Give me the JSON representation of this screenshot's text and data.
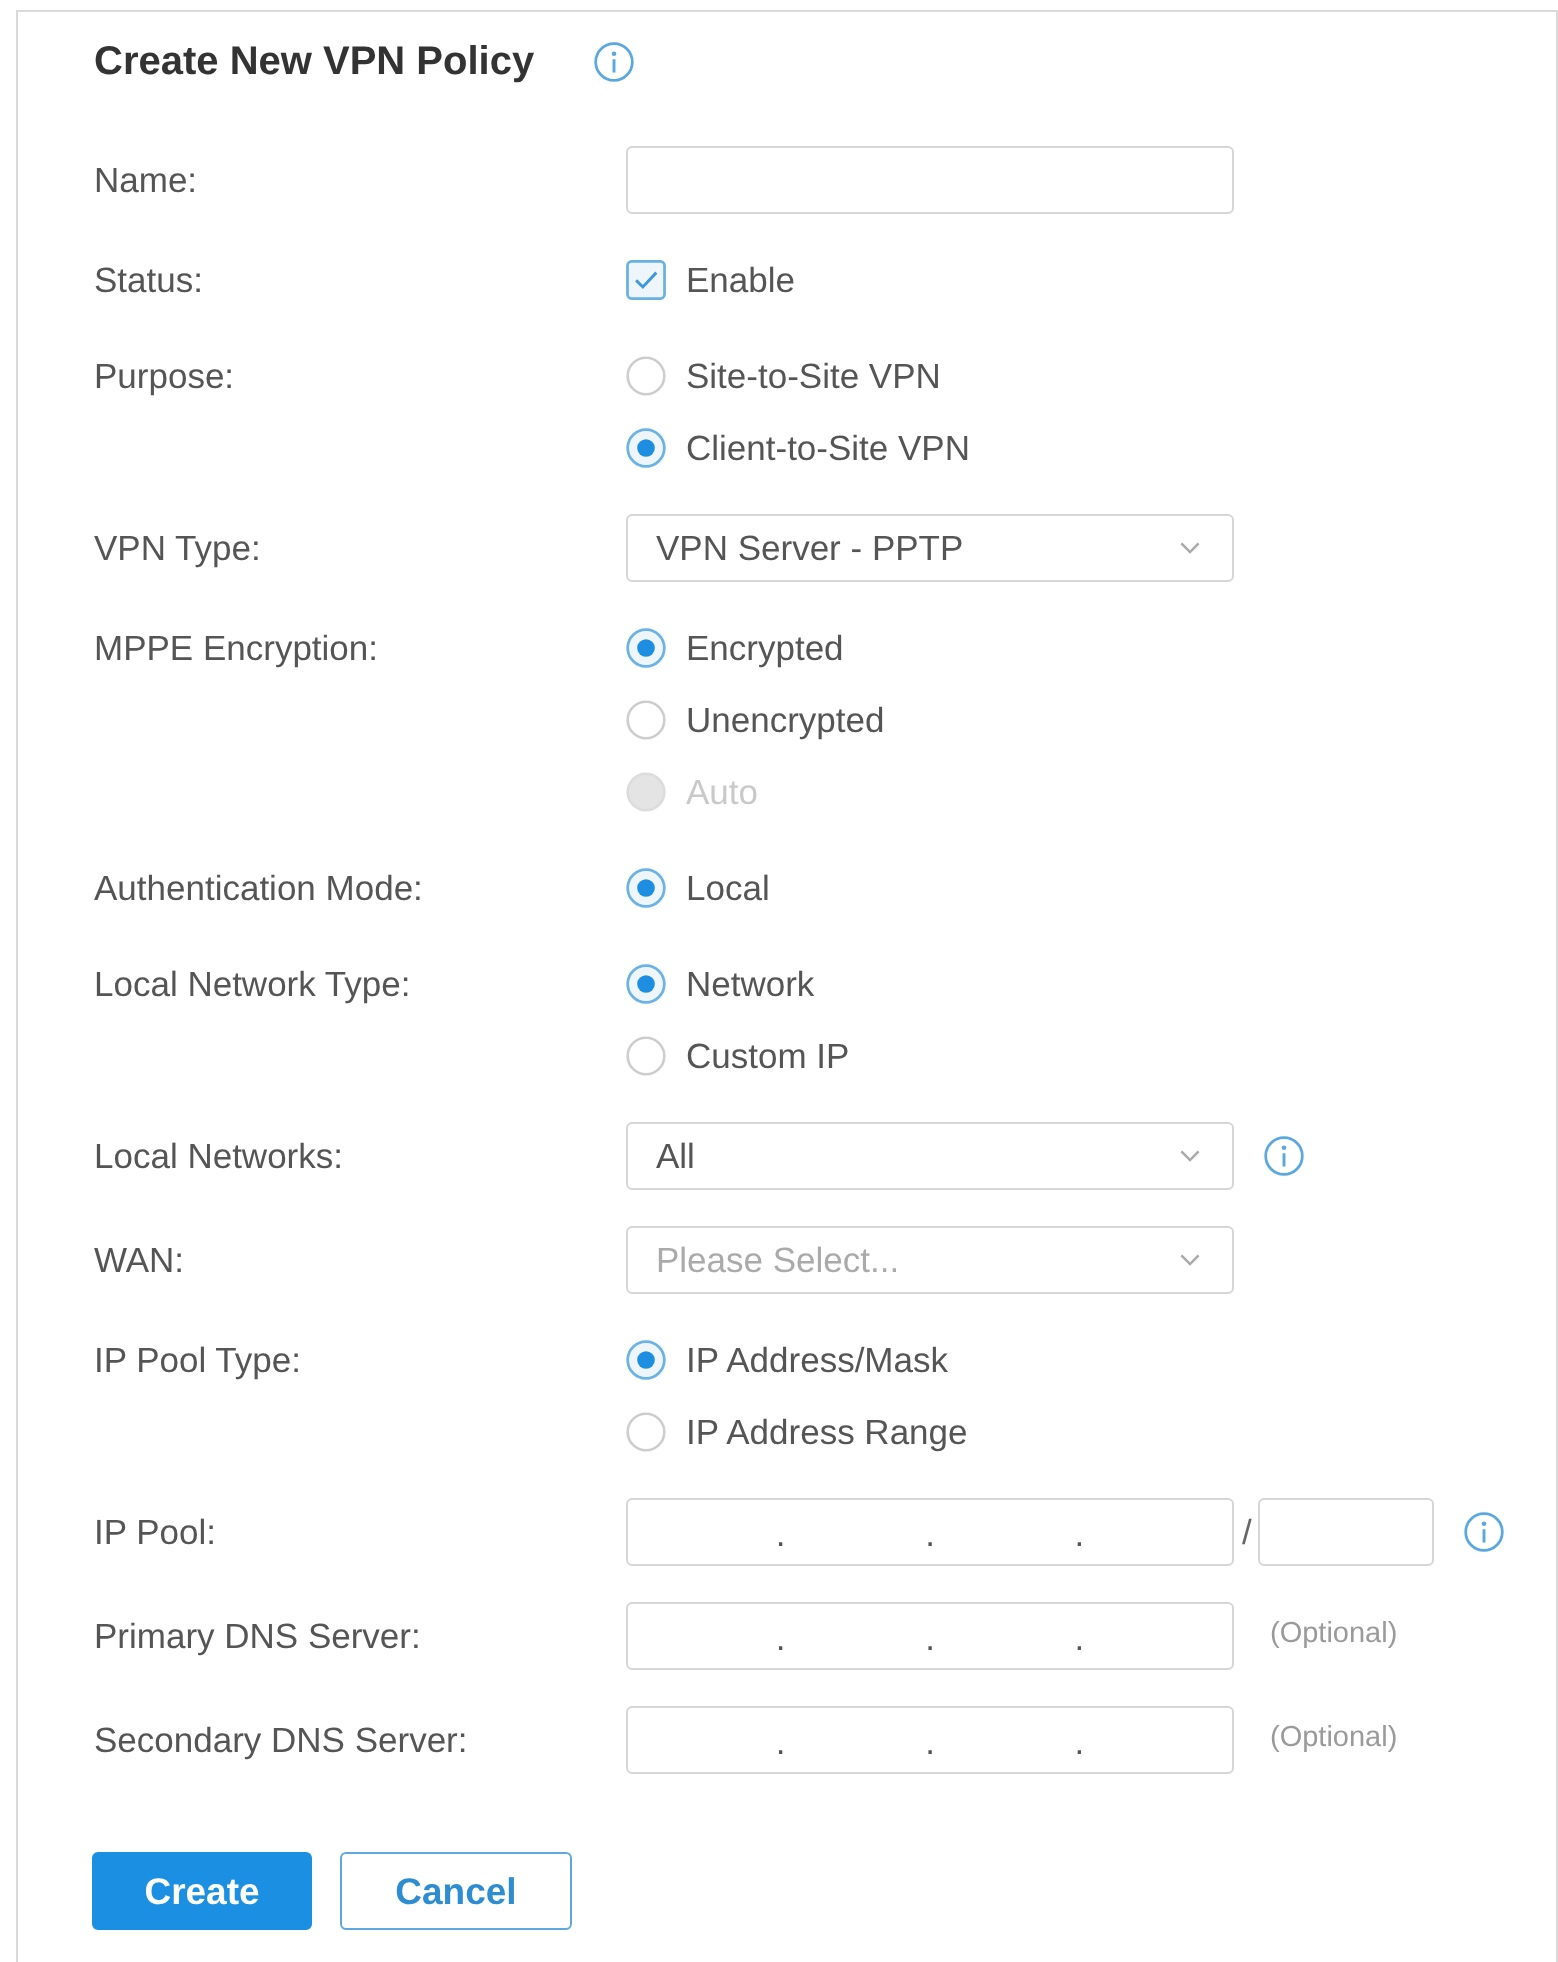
{
  "title": {
    "text": "Create New VPN Policy",
    "info": true
  },
  "fields": [
    {
      "kind": "text",
      "label": "Name:"
    },
    {
      "kind": "checkbox",
      "label": "Status:",
      "option": "Enable",
      "checked": true
    },
    {
      "kind": "radio",
      "label": "Purpose:",
      "options": [
        {
          "label": "Site-to-Site VPN",
          "selected": false,
          "disabled": false
        },
        {
          "label": "Client-to-Site VPN",
          "selected": true,
          "disabled": false
        }
      ]
    },
    {
      "kind": "select",
      "label": "VPN Type:",
      "value": "VPN Server - PPTP"
    },
    {
      "kind": "radio",
      "label": "MPPE Encryption:",
      "options": [
        {
          "label": "Encrypted",
          "selected": true,
          "disabled": false
        },
        {
          "label": "Unencrypted",
          "selected": false,
          "disabled": false
        },
        {
          "label": "Auto",
          "selected": false,
          "disabled": true
        }
      ]
    },
    {
      "kind": "radio",
      "label": "Authentication Mode:",
      "options": [
        {
          "label": "Local",
          "selected": true,
          "disabled": false
        }
      ]
    },
    {
      "kind": "radio",
      "label": "Local Network Type:",
      "options": [
        {
          "label": "Network",
          "selected": true,
          "disabled": false
        },
        {
          "label": "Custom IP",
          "selected": false,
          "disabled": false
        }
      ]
    },
    {
      "kind": "select",
      "label": "Local Networks:",
      "value": "All",
      "info": true
    },
    {
      "kind": "select",
      "label": "WAN:",
      "placeholder": "Please Select..."
    },
    {
      "kind": "radio",
      "label": "IP Pool Type:",
      "options": [
        {
          "label": "IP Address/Mask",
          "selected": true,
          "disabled": false
        },
        {
          "label": "IP Address Range",
          "selected": false,
          "disabled": false
        }
      ]
    },
    {
      "kind": "ip",
      "label": "IP Pool:",
      "separators": [
        ".",
        ".",
        "."
      ],
      "mask_separator": "/",
      "info": true
    },
    {
      "kind": "ip",
      "label": "Primary DNS Server:",
      "separators": [
        ".",
        ".",
        "."
      ],
      "note": "(Optional)"
    },
    {
      "kind": "ip",
      "label": "Secondary DNS Server:",
      "separators": [
        ".",
        ".",
        "."
      ],
      "note": "(Optional)"
    }
  ],
  "buttons": [
    {
      "label": "Create",
      "primary": true
    },
    {
      "label": "Cancel",
      "primary": false
    }
  ]
}
